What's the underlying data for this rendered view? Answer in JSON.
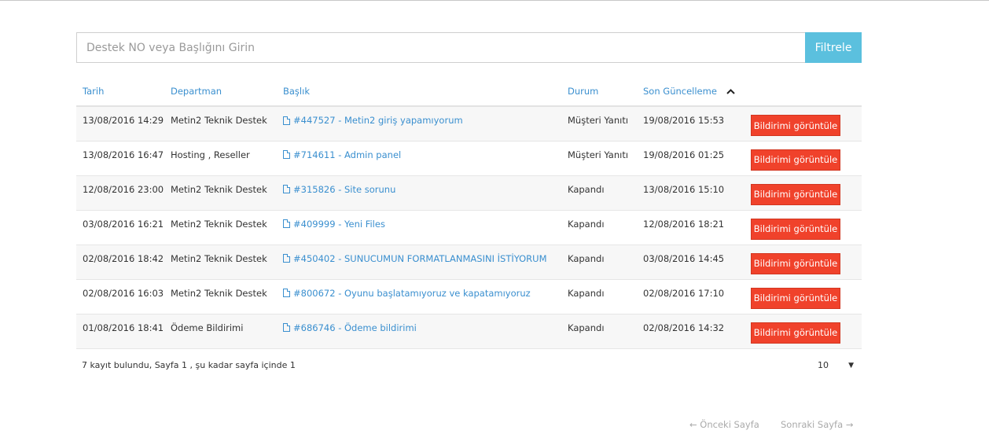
{
  "search": {
    "placeholder": "Destek NO veya Başlığını Girin",
    "button_label": "Filtrele"
  },
  "table": {
    "headers": {
      "date": "Tarih",
      "department": "Departman",
      "title": "Başlık",
      "status": "Durum",
      "updated": "Son Güncelleme"
    },
    "rows": [
      {
        "date": "13/08/2016 14:29",
        "department": "Metin2 Teknik Destek",
        "title": "#447527 - Metin2 giriş yapamıyorum",
        "status": "Müşteri Yanıtı",
        "status_type": "reply",
        "updated": "19/08/2016 15:53",
        "action": "Bildirimi görüntüle"
      },
      {
        "date": "13/08/2016 16:47",
        "department": "Hosting , Reseller",
        "title": "#714611 - Admin panel",
        "status": "Müşteri Yanıtı",
        "status_type": "reply",
        "updated": "19/08/2016 01:25",
        "action": "Bildirimi görüntüle"
      },
      {
        "date": "12/08/2016 23:00",
        "department": "Metin2 Teknik Destek",
        "title": "#315826 - Site sorunu",
        "status": "Kapandı",
        "status_type": "closed",
        "updated": "13/08/2016 15:10",
        "action": "Bildirimi görüntüle"
      },
      {
        "date": "03/08/2016 16:21",
        "department": "Metin2 Teknik Destek",
        "title": "#409999 - Yeni Files",
        "status": "Kapandı",
        "status_type": "closed",
        "updated": "12/08/2016 18:21",
        "action": "Bildirimi görüntüle"
      },
      {
        "date": "02/08/2016 18:42",
        "department": "Metin2 Teknik Destek",
        "title": "#450402 - SUNUCUMUN FORMATLANMASINI İSTİYORUM",
        "status": "Kapandı",
        "status_type": "closed",
        "updated": "03/08/2016 14:45",
        "action": "Bildirimi görüntüle"
      },
      {
        "date": "02/08/2016 16:03",
        "department": "Metin2 Teknik Destek",
        "title": "#800672 - Oyunu başlatamıyoruz ve kapatamıyoruz",
        "status": "Kapandı",
        "status_type": "closed",
        "updated": "02/08/2016 17:10",
        "action": "Bildirimi görüntüle"
      },
      {
        "date": "01/08/2016 18:41",
        "department": "Ödeme Bildirimi",
        "title": "#686746 - Ödeme bildirimi",
        "status": "Kapandı",
        "status_type": "closed",
        "updated": "02/08/2016 14:32",
        "action": "Bildirimi görüntüle"
      }
    ]
  },
  "footer": {
    "info": "7 kayıt bulundu, Sayfa 1 , şu kadar sayfa içinde 1",
    "page_size": "10"
  },
  "pager": {
    "prev": "← Önceki Sayfa",
    "next": "Sonraki Sayfa →"
  },
  "colors": {
    "accent": "#3a8fcf",
    "filter_button": "#5bc0de",
    "action_button": "#f0422b",
    "status_reply": "#e8553c"
  },
  "icons": {
    "title": "document-icon",
    "sort": "chevron-up-icon",
    "page_size": "caret-down-icon"
  }
}
